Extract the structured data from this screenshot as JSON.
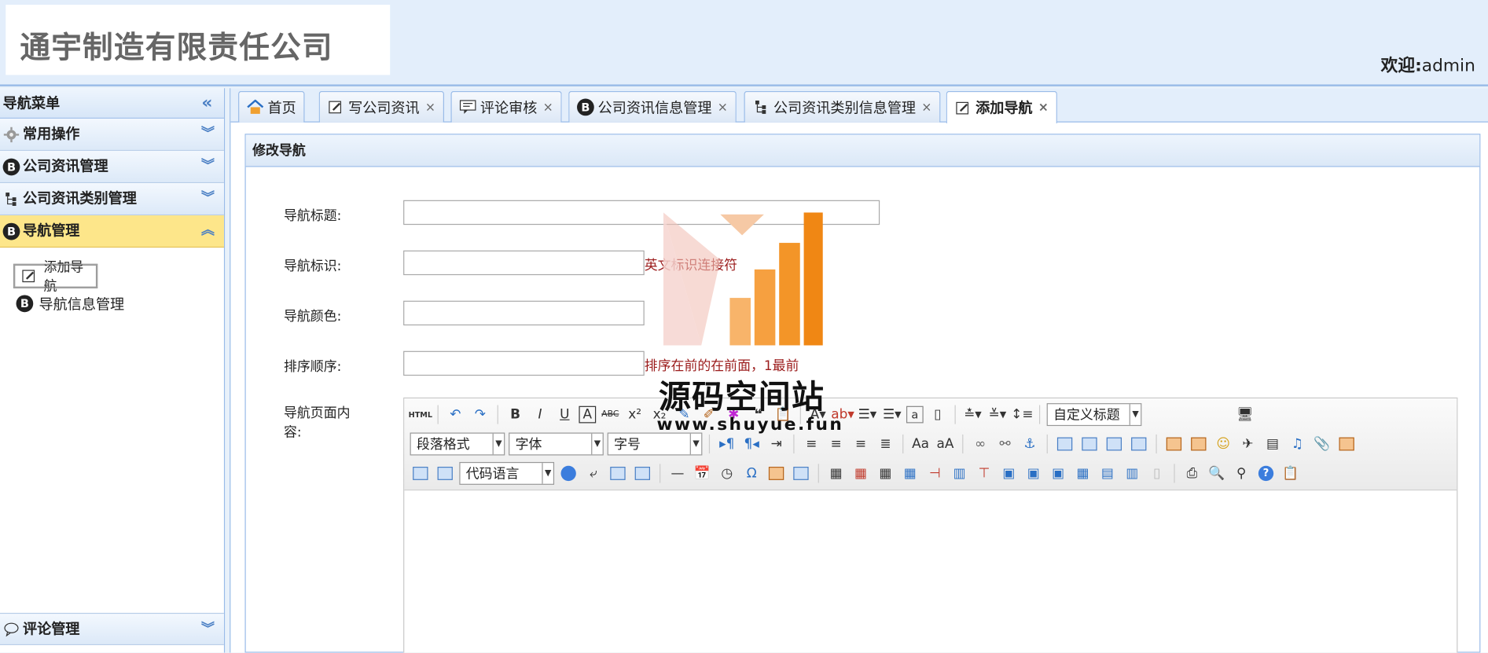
{
  "header": {
    "company": "通宇制造有限责任公司",
    "welcome_label": "欢迎:",
    "user": "admin"
  },
  "sidebar": {
    "title": "导航菜单",
    "sections": [
      {
        "label": "常用操作"
      },
      {
        "label": "公司资讯管理"
      },
      {
        "label": "公司资讯类别管理"
      },
      {
        "label": "导航管理"
      }
    ],
    "sub_items": [
      {
        "label": "添加导航"
      },
      {
        "label": "导航信息管理"
      }
    ],
    "bottom_section": "评论管理"
  },
  "tabs": [
    {
      "label": "首页"
    },
    {
      "label": "写公司资讯"
    },
    {
      "label": "评论审核"
    },
    {
      "label": "公司资讯信息管理"
    },
    {
      "label": "公司资讯类别信息管理"
    },
    {
      "label": "添加导航"
    }
  ],
  "form": {
    "title": "修改导航",
    "fields": {
      "title": {
        "label": "导航标题:",
        "value": ""
      },
      "ident": {
        "label": "导航标识:",
        "value": "",
        "hint": "英文标识连接符"
      },
      "color": {
        "label": "导航颜色:",
        "value": ""
      },
      "order": {
        "label": "排序顺序:",
        "value": "",
        "hint": "排序在前的在前面，1最前"
      },
      "content": {
        "label": "导航页面内容:"
      }
    }
  },
  "editor": {
    "custom_title": "自定义标题",
    "paragraph": "段落格式",
    "font": "字体",
    "size": "字号",
    "code_lang": "代码语言"
  },
  "watermark": {
    "title": "源码空间站",
    "url": "www.shuyue.fun"
  }
}
